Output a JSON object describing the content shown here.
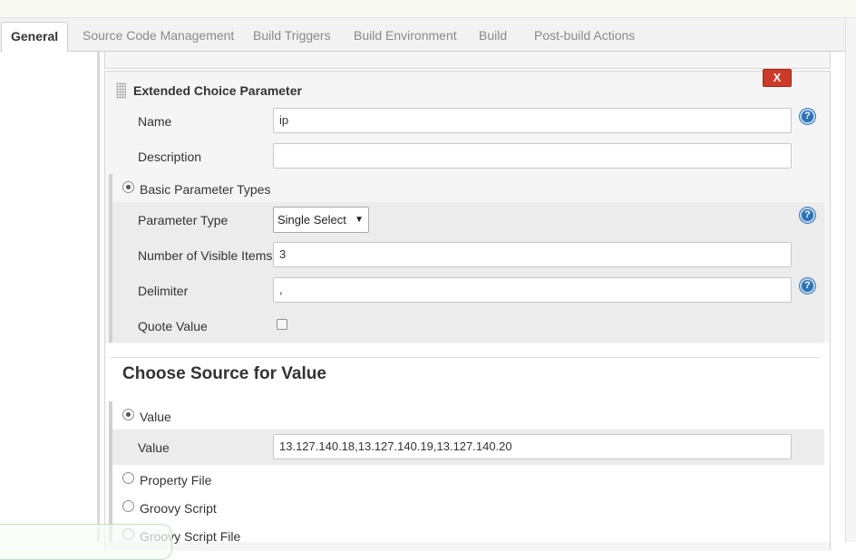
{
  "tabs": [
    {
      "label": "General"
    },
    {
      "label": "Source Code Management"
    },
    {
      "label": "Build Triggers"
    },
    {
      "label": "Build Environment"
    },
    {
      "label": "Build"
    },
    {
      "label": "Post-build Actions"
    }
  ],
  "active_tab": "General",
  "param": {
    "title": "Extended Choice Parameter",
    "delete_label": "X",
    "help_glyph": "?",
    "name_label": "Name",
    "name_value": "ip",
    "description_label": "Description",
    "description_value": "",
    "basic_types_label": "Basic Parameter Types",
    "parameter_type_label": "Parameter Type",
    "parameter_type_value": "Single Select",
    "visible_items_label": "Number of Visible Items",
    "visible_items_value": "3",
    "delimiter_label": "Delimiter",
    "delimiter_value": ",",
    "quote_value_label": "Quote Value",
    "quote_value_checked": false
  },
  "source": {
    "heading": "Choose Source for Value",
    "value_radio_label": "Value",
    "value_field_label": "Value",
    "value_field_value": "13.127.140.18,13.127.140.19,13.127.140.20",
    "property_file_label": "Property File",
    "groovy_script_label": "Groovy Script",
    "groovy_script_file_label": "Groovy Script File",
    "selected": "Value"
  },
  "colors": {
    "accent_blue": "#2d73b4",
    "delete_red": "#cc3a2a",
    "panel_bg": "#f5f5f5"
  }
}
